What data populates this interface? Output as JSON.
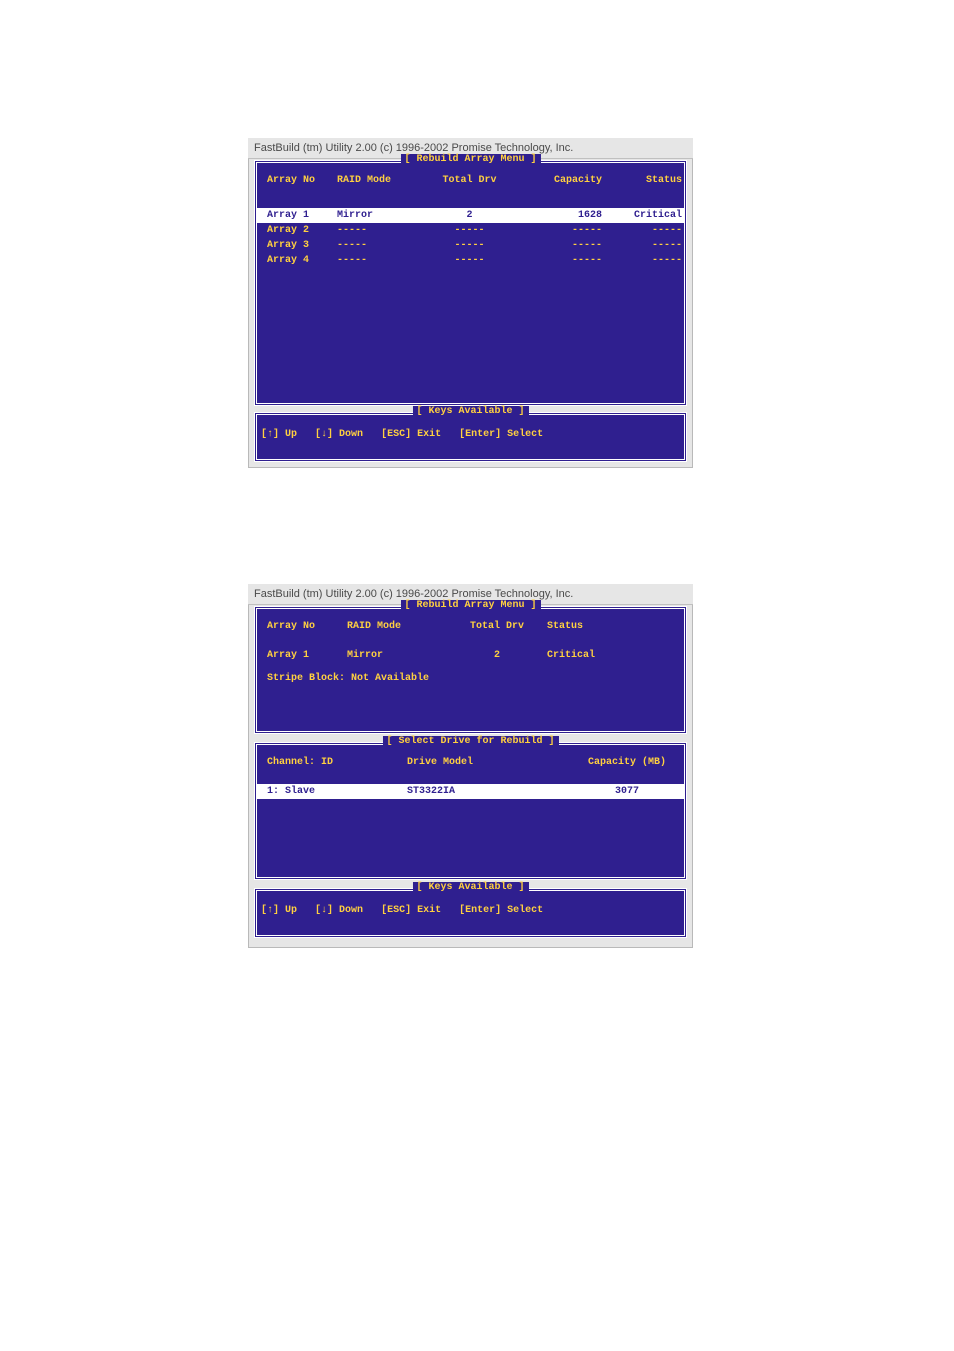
{
  "shot1": {
    "titlebar": "FastBuild (tm) Utility 2.00 (c) 1996-2002 Promise Technology, Inc.",
    "panel_top": {
      "title": "[ Rebuild Array Menu ]",
      "headers": [
        "Array No",
        "RAID Mode",
        "Total Drv",
        "Capacity",
        "Status"
      ],
      "rows": [
        {
          "array_no": "Array  1",
          "raid_mode": "Mirror",
          "total_drv": "2",
          "capacity": "1628",
          "status": "Critical"
        },
        {
          "array_no": "Array  2",
          "raid_mode": "-----",
          "total_drv": "-----",
          "capacity": "-----",
          "status": "-----"
        },
        {
          "array_no": "Array  3",
          "raid_mode": "-----",
          "total_drv": "-----",
          "capacity": "-----",
          "status": "-----"
        },
        {
          "array_no": "Array  4",
          "raid_mode": "-----",
          "total_drv": "-----",
          "capacity": "-----",
          "status": "-----"
        }
      ]
    },
    "panel_keys": {
      "title": "[ Keys Available ]",
      "keys": [
        "[↑] Up",
        "[↓] Down",
        "[ESC] Exit",
        "[Enter] Select"
      ]
    }
  },
  "shot2": {
    "titlebar": "FastBuild (tm) Utility 2.00 (c) 1996-2002 Promise Technology, Inc.",
    "panel_top": {
      "title": "[ Rebuild Array Menu ]",
      "headers": [
        "Array No",
        "RAID Mode",
        "Total Drv",
        "Status"
      ],
      "row": {
        "array_no": "Array  1",
        "raid_mode": "Mirror",
        "total_drv": "2",
        "status": "Critical"
      },
      "stripe_note": "Stripe Block: Not Available"
    },
    "panel_drive": {
      "title": "[ Select Drive for Rebuild ]",
      "headers": [
        "Channel: ID",
        "Drive Model",
        "Capacity (MB)"
      ],
      "row": {
        "channel": "1: Slave",
        "model": "ST3322IA",
        "capacity": "3077"
      }
    },
    "panel_keys": {
      "title": "[ Keys Available ]",
      "keys": [
        "[↑] Up",
        "[↓] Down",
        "[ESC] Exit",
        "[Enter] Select"
      ]
    }
  }
}
